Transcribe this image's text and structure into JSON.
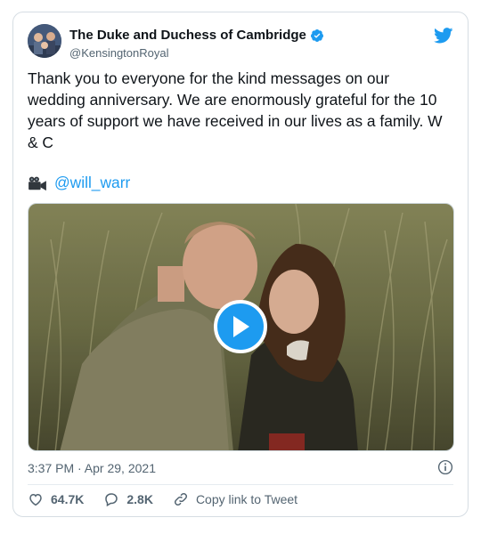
{
  "author": {
    "display_name": "The Duke and Duchess of Cambridge",
    "handle": "@KensingtonRoyal",
    "verified_icon": "verified-badge-icon",
    "brand_color": "#1d9bf0"
  },
  "tweet": {
    "text": "Thank you to everyone for the kind messages on our\nwedding anniversary. We are enormously grateful for the 10\nyears of support we have received in our lives as a family. W\n& C",
    "credit_handle": "@will_warr",
    "credit_icon": "movie-camera-icon",
    "media_type": "video",
    "timestamp": "3:37 PM · Apr 29, 2021"
  },
  "actions": {
    "likes": "64.7K",
    "replies": "2.8K",
    "copy_link": "Copy link to Tweet"
  }
}
